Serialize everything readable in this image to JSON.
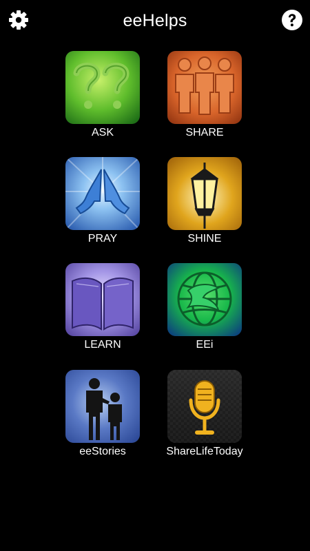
{
  "header": {
    "title": "eeHelps"
  },
  "tiles": [
    {
      "label": "ASK",
      "icon": "question-marks-icon"
    },
    {
      "label": "SHARE",
      "icon": "people-icon"
    },
    {
      "label": "PRAY",
      "icon": "praying-hands-icon"
    },
    {
      "label": "SHINE",
      "icon": "lantern-icon"
    },
    {
      "label": "LEARN",
      "icon": "open-book-icon"
    },
    {
      "label": "EEi",
      "icon": "globe-icon"
    },
    {
      "label": "eeStories",
      "icon": "parent-child-icon"
    },
    {
      "label": "ShareLifeToday",
      "icon": "microphone-icon"
    }
  ],
  "colors": {
    "ask": "#5fbd2c",
    "share": "#d8642a",
    "pray": "#3d7fd6",
    "shine": "#e0a51d",
    "learn": "#7a6ac9",
    "eei": "#18b84a",
    "eestories": "#5a79c5",
    "sharelifetoday": "#1f1f1f"
  }
}
